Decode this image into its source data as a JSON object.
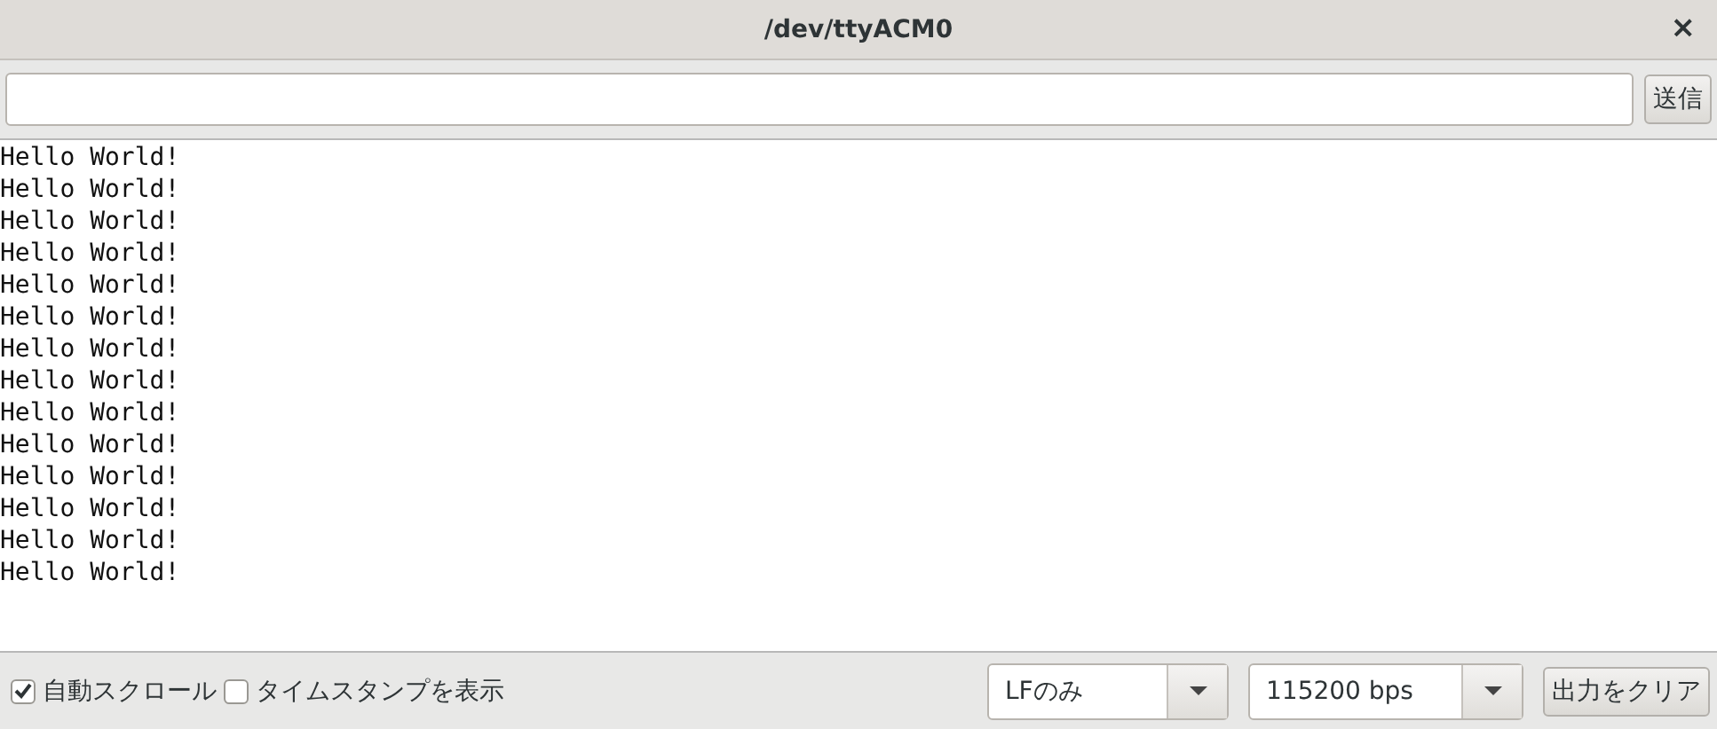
{
  "window": {
    "title": "/dev/ttyACM0",
    "close": "×"
  },
  "send_row": {
    "send_button": "送信"
  },
  "output_lines": [
    "Hello World!",
    "Hello World!",
    "Hello World!",
    "Hello World!",
    "Hello World!",
    "Hello World!",
    "Hello World!",
    "Hello World!",
    "Hello World!",
    "Hello World!",
    "Hello World!",
    "Hello World!",
    "Hello World!",
    "Hello World!"
  ],
  "bottom_bar": {
    "checkboxes": [
      {
        "label": "自動スクロール",
        "checked": true
      },
      {
        "label": "タイムスタンプを表示",
        "checked": false
      }
    ],
    "line_ending": {
      "value": "LFのみ"
    },
    "baud_rate": {
      "value": "115200 bps"
    },
    "clear_button": "出力をクリア"
  }
}
